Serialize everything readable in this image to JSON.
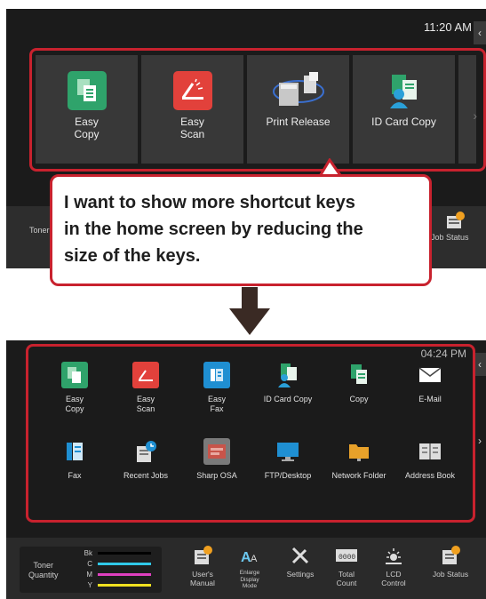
{
  "top_screen": {
    "time": "11:20 AM",
    "tab_glyph": "‹",
    "scroll_glyph": "›",
    "shortcuts": [
      {
        "label": "Easy\nCopy",
        "icon": "easy-copy-icon",
        "color": "#2fa36b"
      },
      {
        "label": "Easy\nScan",
        "icon": "easy-scan-icon",
        "color": "#e2413b"
      },
      {
        "label": "Print Release",
        "icon": "print-release-icon",
        "color": "#d0d0d0"
      },
      {
        "label": "ID Card Copy",
        "icon": "id-card-copy-icon",
        "color": "#2aa0d8"
      }
    ],
    "toner_label": "Toner\nQuanti",
    "job_status_label": "Job Status"
  },
  "callout": {
    "text": "I want to show more shortcut keys\nin the home screen by reducing the\nsize of the keys."
  },
  "bottom_screen": {
    "time": "04:24 PM",
    "tab_glyph": "‹",
    "shortcuts": [
      {
        "label": "Easy\nCopy",
        "icon": "easy-copy-icon",
        "color": "#2fa36b"
      },
      {
        "label": "Easy\nScan",
        "icon": "easy-scan-icon",
        "color": "#e2413b"
      },
      {
        "label": "Easy\nFax",
        "icon": "easy-fax-icon",
        "color": "#1f8fd2"
      },
      {
        "label": "ID Card Copy",
        "icon": "id-card-copy-icon",
        "color": "#2aa0d8"
      },
      {
        "label": "Copy",
        "icon": "copy-icon",
        "color": "#2fa36b"
      },
      {
        "label": "E-Mail",
        "icon": "email-icon",
        "color": "#ffffff"
      },
      {
        "label": "Fax",
        "icon": "fax-icon",
        "color": "#1f8fd2"
      },
      {
        "label": "Recent Jobs",
        "icon": "recent-jobs-icon",
        "color": "#dddddd"
      },
      {
        "label": "Sharp OSA",
        "icon": "sharp-osa-icon",
        "color": "#c8544a"
      },
      {
        "label": "FTP/Desktop",
        "icon": "ftp-desktop-icon",
        "color": "#1f8fd2"
      },
      {
        "label": "Network Folder",
        "icon": "network-folder-icon",
        "color": "#e8a12a"
      },
      {
        "label": "Address Book",
        "icon": "address-book-icon",
        "color": "#dddddd"
      }
    ],
    "toner": {
      "title": "Toner\nQuantity",
      "rows": [
        {
          "name": "Bk",
          "color": "#000000"
        },
        {
          "name": "C",
          "color": "#30c8e8"
        },
        {
          "name": "M",
          "color": "#e040c0"
        },
        {
          "name": "Y",
          "color": "#f0e020"
        }
      ]
    },
    "bar_items": [
      {
        "label": "User's\nManual",
        "icon": "users-manual-icon"
      },
      {
        "label": "Enlarge\nDisplay\nMode",
        "icon": "enlarge-display-mode-icon"
      },
      {
        "label": "Settings",
        "icon": "settings-icon"
      },
      {
        "label": "Total\nCount",
        "icon": "total-count-icon",
        "icon_text": "0000"
      },
      {
        "label": "LCD\nControl",
        "icon": "lcd-control-icon"
      },
      {
        "label": "Job Status",
        "icon": "job-status-icon"
      }
    ]
  }
}
